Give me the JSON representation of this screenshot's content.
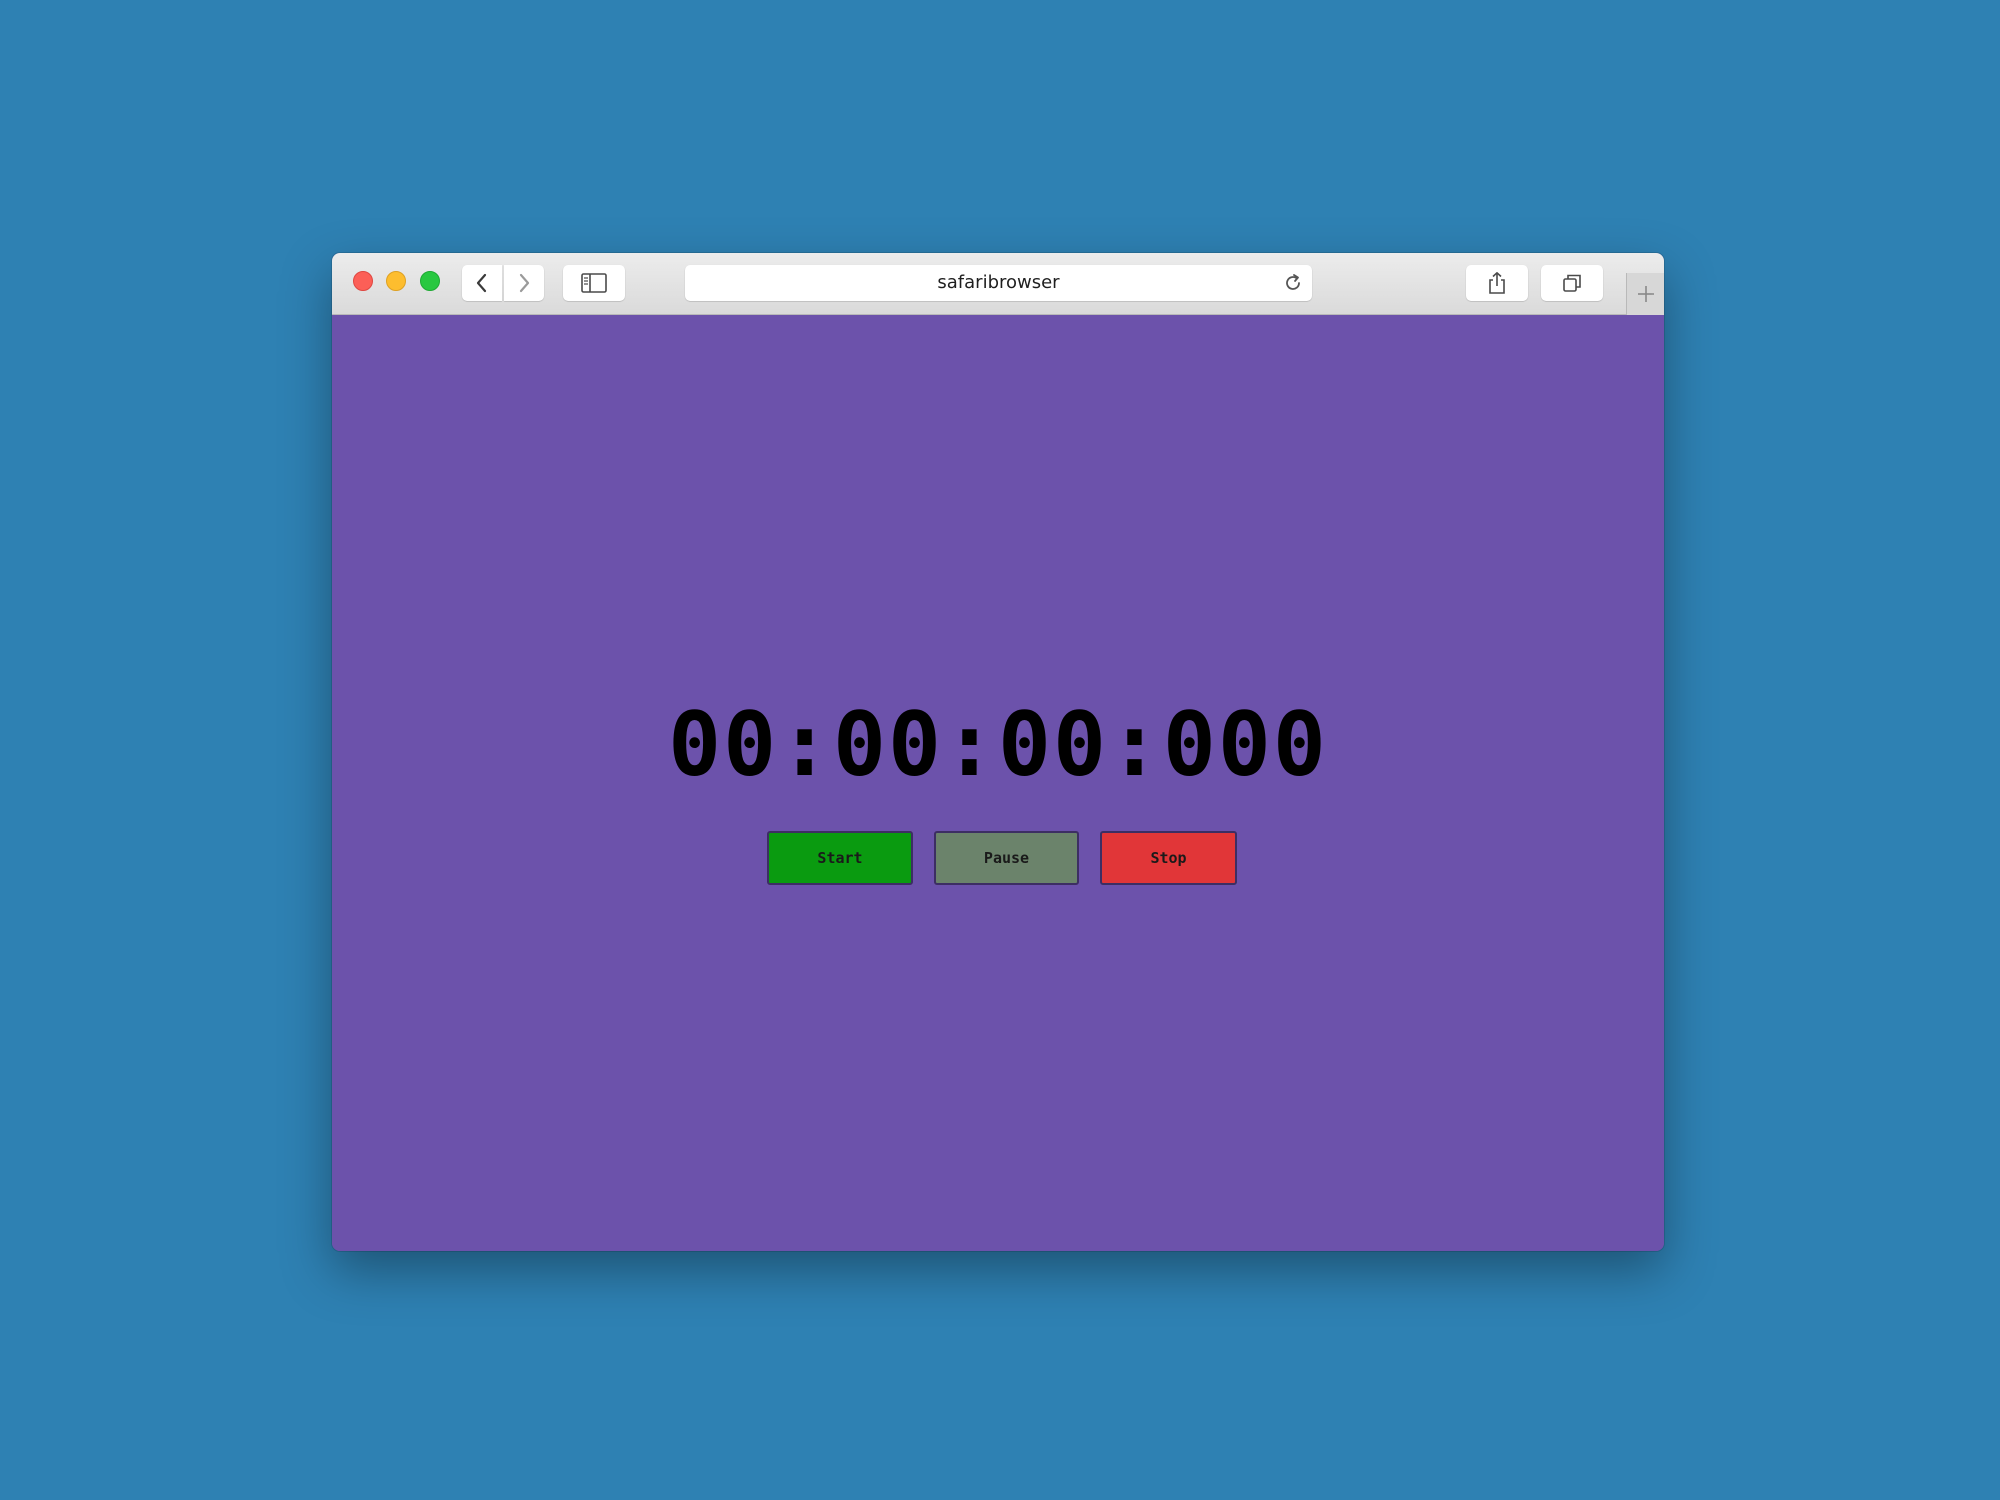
{
  "browser": {
    "address_text": "safaribrowser",
    "buttons": {
      "back": "chevron-left-icon",
      "forward": "chevron-right-icon",
      "sidebar": "sidebar-icon",
      "reload": "reload-icon",
      "share": "share-icon",
      "tabs": "tabs-overview-icon",
      "new_tab": "plus-icon"
    }
  },
  "stopwatch": {
    "display": "00:00:00:000",
    "start_label": "Start",
    "pause_label": "Pause",
    "stop_label": "Stop"
  },
  "colors": {
    "desktop_bg": "#2e81b3",
    "page_bg": "#6c52ab",
    "start": "#0a9b10",
    "pause": "#6b836b",
    "stop": "#e13638"
  }
}
